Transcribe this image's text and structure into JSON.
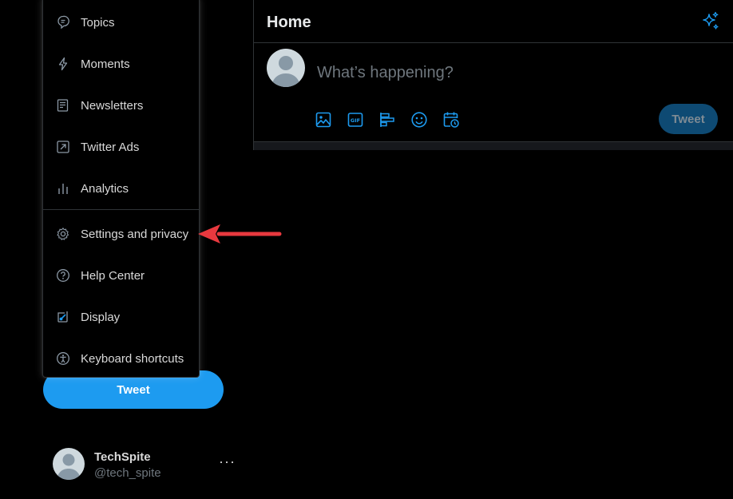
{
  "menu": {
    "items": [
      {
        "label": "Topics",
        "icon": "topics-icon"
      },
      {
        "label": "Moments",
        "icon": "lightning-icon"
      },
      {
        "label": "Newsletters",
        "icon": "newsletter-icon"
      },
      {
        "label": "Twitter Ads",
        "icon": "external-arrow-icon"
      },
      {
        "label": "Analytics",
        "icon": "analytics-icon"
      },
      {
        "label": "Settings and privacy",
        "icon": "gear-icon"
      },
      {
        "label": "Help Center",
        "icon": "help-icon"
      },
      {
        "label": "Display",
        "icon": "display-icon"
      },
      {
        "label": "Keyboard shortcuts",
        "icon": "accessibility-icon"
      }
    ]
  },
  "sidebar": {
    "tweet_label": "Tweet"
  },
  "account": {
    "name": "TechSpite",
    "handle": "@tech_spite",
    "more": "···"
  },
  "main": {
    "title": "Home",
    "composer_placeholder": "What’s happening?",
    "tweet_label": "Tweet",
    "tools": [
      "image-icon",
      "gif-icon",
      "poll-icon",
      "emoji-icon",
      "schedule-icon"
    ]
  },
  "colors": {
    "accent": "#1d9bf0",
    "annotation_arrow": "#e8393f",
    "background": "#000000",
    "border": "#2f3336"
  }
}
